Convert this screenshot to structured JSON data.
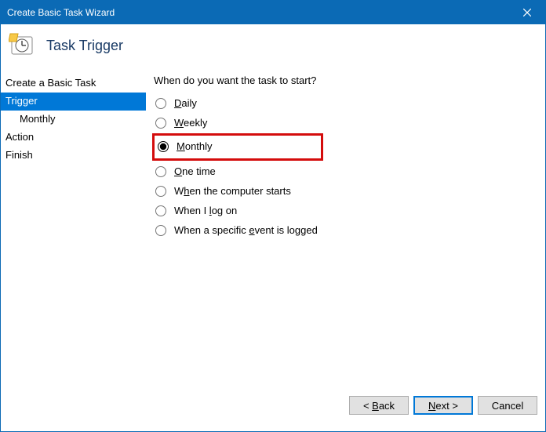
{
  "window": {
    "title": "Create Basic Task Wizard"
  },
  "header": {
    "title": "Task Trigger"
  },
  "sidebar": {
    "items": [
      {
        "label": "Create a Basic Task",
        "selected": false,
        "sub": false
      },
      {
        "label": "Trigger",
        "selected": true,
        "sub": false
      },
      {
        "label": "Monthly",
        "selected": false,
        "sub": true
      },
      {
        "label": "Action",
        "selected": false,
        "sub": false
      },
      {
        "label": "Finish",
        "selected": false,
        "sub": false
      }
    ]
  },
  "content": {
    "question": "When do you want the task to start?",
    "options": [
      {
        "key": "D",
        "rest": "aily",
        "checked": false,
        "highlight": false
      },
      {
        "key": "W",
        "rest": "eekly",
        "checked": false,
        "highlight": false
      },
      {
        "key": "M",
        "rest": "onthly",
        "checked": true,
        "highlight": true
      },
      {
        "key": "O",
        "rest": "ne time",
        "checked": false,
        "highlight": false
      },
      {
        "key": "",
        "rest": "W",
        "key2": "h",
        "rest2": "en the computer starts",
        "checked": false,
        "highlight": false
      },
      {
        "key": "",
        "rest": "When I ",
        "key2": "l",
        "rest2": "og on",
        "checked": false,
        "highlight": false
      },
      {
        "key": "",
        "rest": "When a specific ",
        "key2": "e",
        "rest2": "vent is logged",
        "checked": false,
        "highlight": false
      }
    ]
  },
  "footer": {
    "back": "< Back",
    "next": "Next >",
    "cancel": "Cancel",
    "back_key": "B",
    "next_key": "N"
  }
}
